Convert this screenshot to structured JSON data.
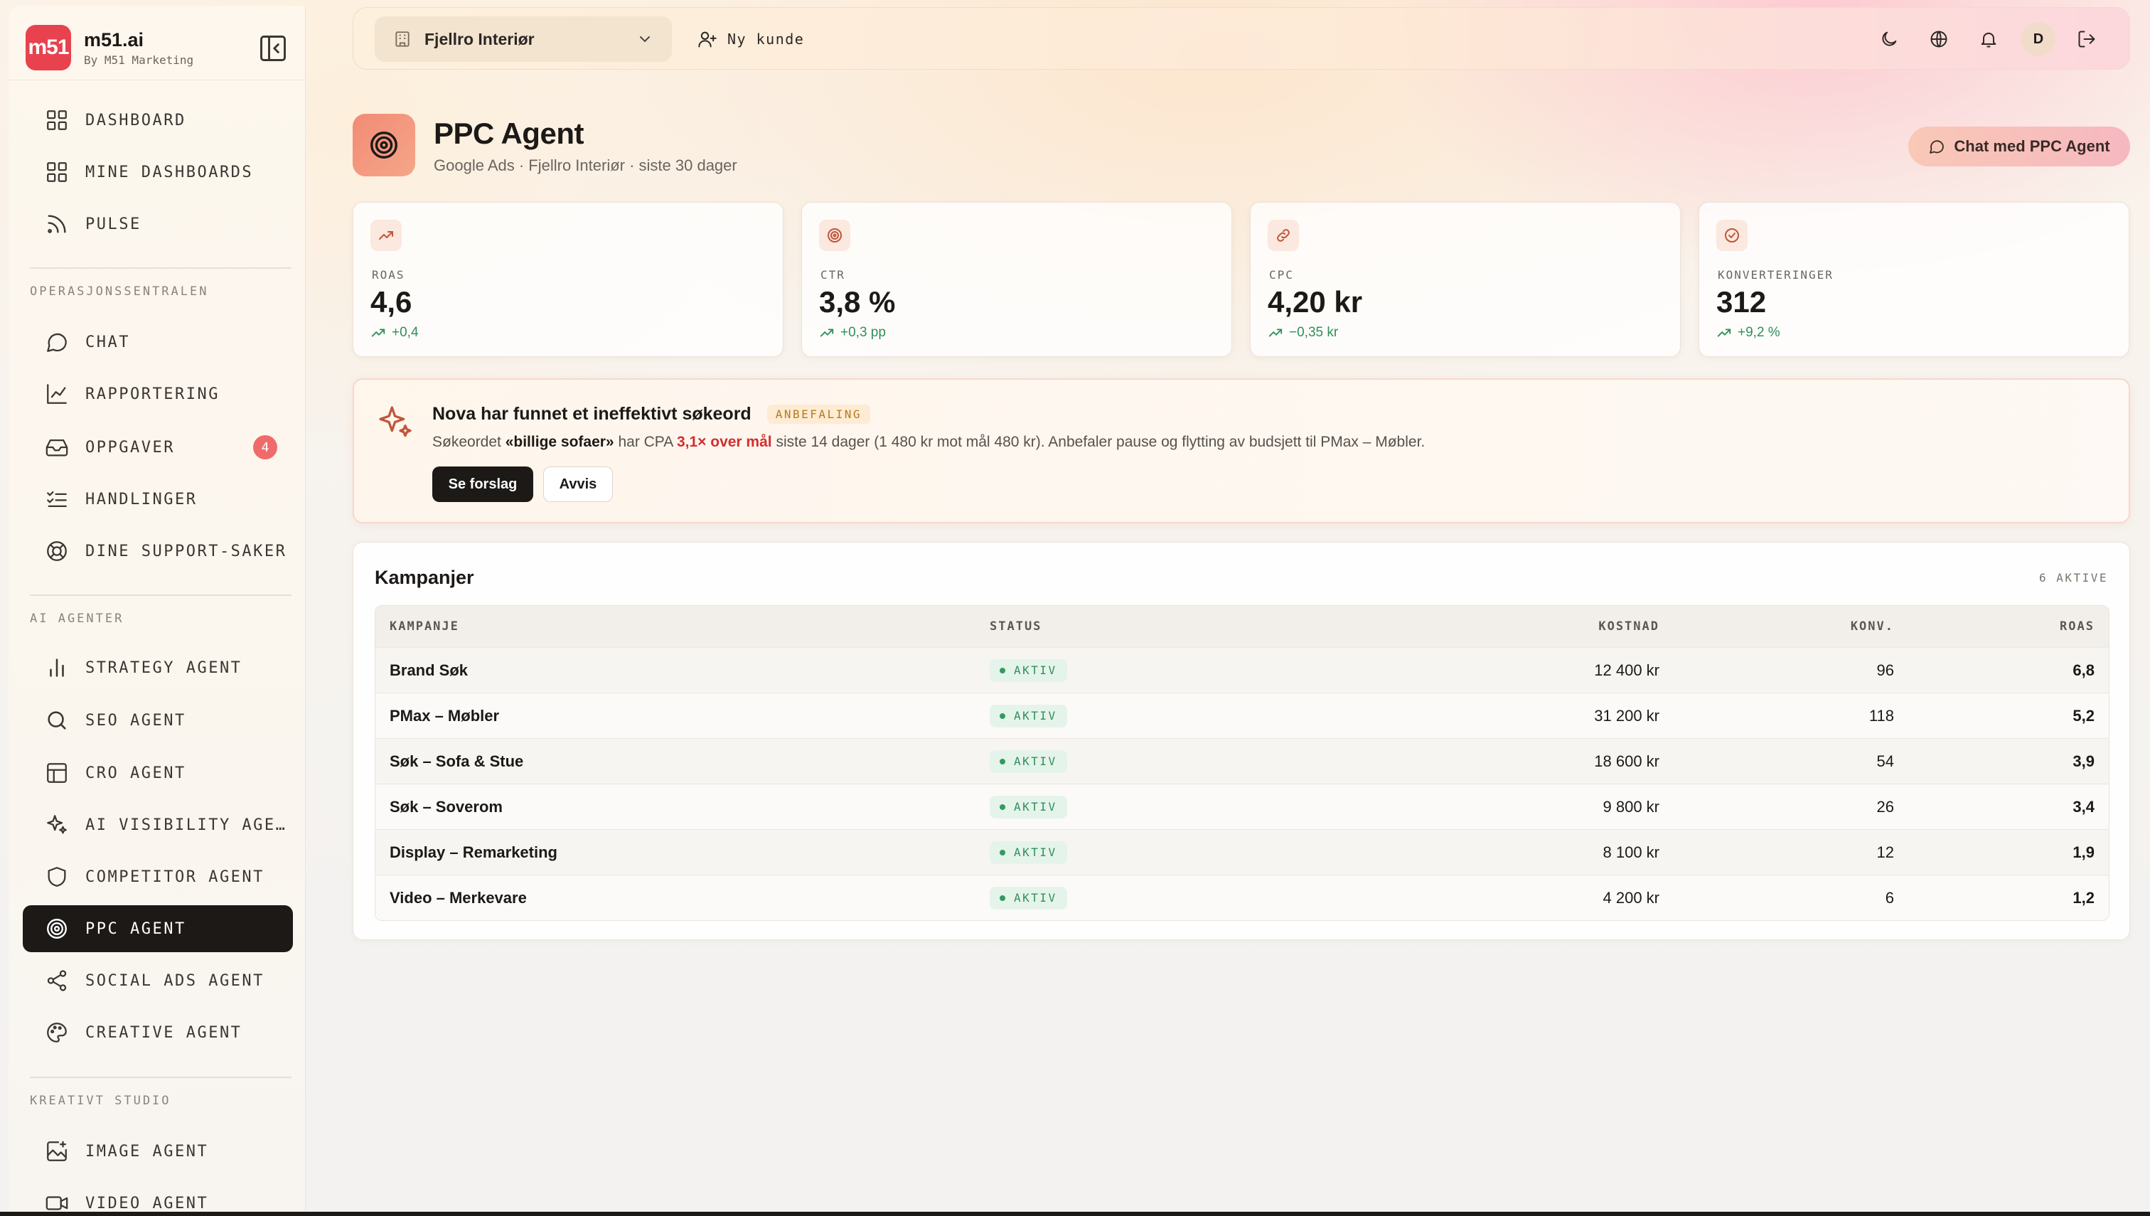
{
  "brand": {
    "name": "m51.ai",
    "subtitle": "By M51 Marketing",
    "logo_text": "m51"
  },
  "sidebar": {
    "items": [
      {
        "label": "DASHBOARD",
        "icon": "grid-icon"
      },
      {
        "label": "MINE DASHBOARDS",
        "icon": "grid-icon"
      },
      {
        "label": "PULSE",
        "icon": "rss-icon"
      },
      {
        "label": "CHAT",
        "icon": "chat-bubble-icon"
      },
      {
        "label": "RAPPORTERING",
        "icon": "line-chart-icon"
      },
      {
        "label": "OPPGAVER",
        "icon": "inbox-icon",
        "badge": "4"
      },
      {
        "label": "HANDLINGER",
        "icon": "checklist-icon"
      },
      {
        "label": "DINE SUPPORT-SAKER",
        "icon": "lifebuoy-icon"
      },
      {
        "label": "STRATEGY AGENT",
        "icon": "bar-chart-icon"
      },
      {
        "label": "SEO AGENT",
        "icon": "search-icon"
      },
      {
        "label": "CRO AGENT",
        "icon": "layout-icon"
      },
      {
        "label": "AI VISIBILITY AGE…",
        "icon": "sparkles-icon"
      },
      {
        "label": "COMPETITOR AGENT",
        "icon": "shield-icon"
      },
      {
        "label": "PPC AGENT",
        "icon": "target-icon"
      },
      {
        "label": "SOCIAL ADS AGENT",
        "icon": "share-icon"
      },
      {
        "label": "CREATIVE AGENT",
        "icon": "palette-icon"
      },
      {
        "label": "IMAGE AGENT",
        "icon": "image-plus-icon"
      },
      {
        "label": "VIDEO AGENT",
        "icon": "video-icon"
      }
    ],
    "sections": {
      "ops": "OPERASJONSSENTRALEN",
      "agents": "AI AGENTER",
      "studio": "KREATIVT STUDIO"
    }
  },
  "topbar": {
    "client": "Fjellro Interiør",
    "new_client": "Ny kunde",
    "avatar": "D"
  },
  "header": {
    "title": "PPC Agent",
    "subtitle": "Google Ads · Fjellro Interiør · siste 30 dager",
    "chat_button": "Chat med PPC Agent"
  },
  "stats": [
    {
      "label": "ROAS",
      "value": "4,6",
      "delta": "+0,4",
      "icon": "trending-up-icon"
    },
    {
      "label": "CTR",
      "value": "3,8 %",
      "delta": "+0,3 pp",
      "icon": "target-icon"
    },
    {
      "label": "CPC",
      "value": "4,20 kr",
      "delta": "−0,35 kr",
      "icon": "link-icon"
    },
    {
      "label": "KONVERTERINGER",
      "value": "312",
      "delta": "+9,2 %",
      "icon": "check-circle-icon"
    }
  ],
  "recommendation": {
    "title": "Nova har funnet et ineffektivt søkeord",
    "tag": "ANBEFALING",
    "body_prefix": "Søkeordet ",
    "keyword": "«billige sofaer»",
    "body_mid": " har CPA ",
    "highlight": "3,1× over mål",
    "body_suffix": " siste 14 dager (1 480 kr mot mål 480 kr). Anbefaler pause og flytting av budsjett til PMax – Møbler.",
    "primary": "Se forslag",
    "secondary": "Avvis"
  },
  "campaigns": {
    "title": "Kampanjer",
    "count": "6 AKTIVE",
    "columns": [
      "KAMPANJE",
      "STATUS",
      "KOSTNAD",
      "KONV.",
      "ROAS"
    ],
    "rows": [
      {
        "name": "Brand Søk",
        "status": "AKTIV",
        "cost": "12 400 kr",
        "conv": "96",
        "roas": "6,8"
      },
      {
        "name": "PMax – Møbler",
        "status": "AKTIV",
        "cost": "31 200 kr",
        "conv": "118",
        "roas": "5,2"
      },
      {
        "name": "Søk – Sofa & Stue",
        "status": "AKTIV",
        "cost": "18 600 kr",
        "conv": "54",
        "roas": "3,9"
      },
      {
        "name": "Søk – Soverom",
        "status": "AKTIV",
        "cost": "9 800 kr",
        "conv": "26",
        "roas": "3,4"
      },
      {
        "name": "Display – Remarketing",
        "status": "AKTIV",
        "cost": "8 100 kr",
        "conv": "12",
        "roas": "1,9"
      },
      {
        "name": "Video – Merkevare",
        "status": "AKTIV",
        "cost": "4 200 kr",
        "conv": "6",
        "roas": "1,2"
      }
    ]
  },
  "colors": {
    "accent": "#e8424f",
    "dark": "#1c1917",
    "positive": "#2f8f5b",
    "warning": "#d12f2f"
  }
}
